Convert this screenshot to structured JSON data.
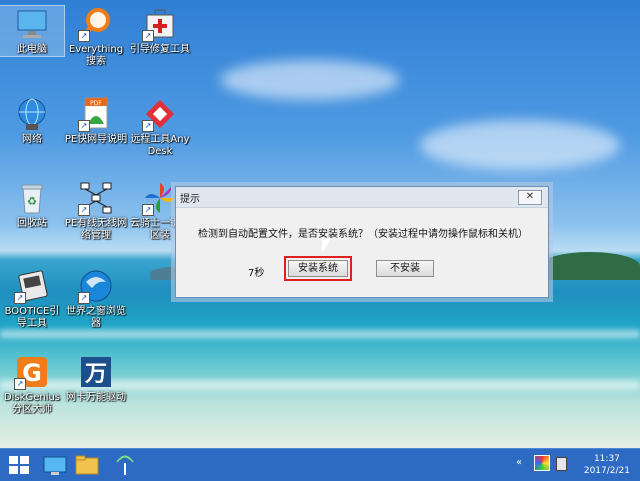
{
  "desktop": {
    "icons": [
      {
        "label": "此电脑"
      },
      {
        "label": "Everything搜索"
      },
      {
        "label": "引导修复工具"
      },
      {
        "label": "网络"
      },
      {
        "label": "PE快网导说明"
      },
      {
        "label": "远程工具AnyDesk"
      },
      {
        "label": "回收站"
      },
      {
        "label": "PE有线无线网络管理"
      },
      {
        "label": "云骑士一键分区装"
      },
      {
        "label": "BOOTICE引导工具"
      },
      {
        "label": "世界之窗浏览器"
      },
      {
        "label": "DiskGenius分区大师"
      },
      {
        "label": "网卡万能驱动"
      }
    ]
  },
  "dialog": {
    "title": "提示",
    "close_label": "✕",
    "message": "检测到自动配置文件，是否安装系统？（安装过程中请勿操作鼠标和关机）",
    "countdown": "7秒",
    "install_label": "安装系统",
    "no_install_label": "不安装"
  },
  "taskbar": {
    "tray_chevron": "«",
    "time": "11:37",
    "date": "2017/2/21"
  },
  "colors": {
    "taskbar": "#2d6ac4",
    "highlight": "#e02020"
  }
}
